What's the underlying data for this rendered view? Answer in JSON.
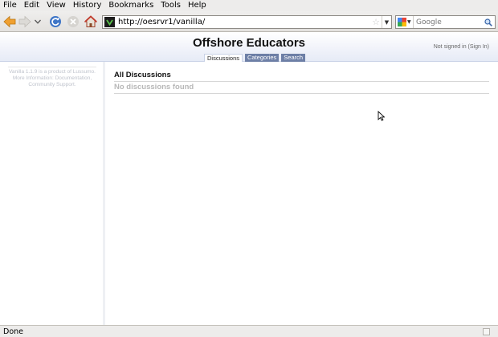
{
  "browser": {
    "menu": [
      "File",
      "Edit",
      "View",
      "History",
      "Bookmarks",
      "Tools",
      "Help"
    ],
    "url": "http://oesrvr1/vanilla/",
    "search_placeholder": "Google",
    "status": "Done"
  },
  "site": {
    "title": "Offshore Educators",
    "tabs": [
      "Discussions",
      "Categories",
      "Search"
    ],
    "signin": "Not signed in (Sign In)",
    "sidebar_text": "Vanilla 1.1.9 is a product of Lussumo. More Information: Documentation, Community Support."
  },
  "main": {
    "heading": "All Discussions",
    "empty_message": "No discussions found"
  },
  "colors": {
    "tab_bg": "#6d7fa6",
    "header_bg": "#e6ebf6",
    "chrome_bg": "#edeceb"
  }
}
